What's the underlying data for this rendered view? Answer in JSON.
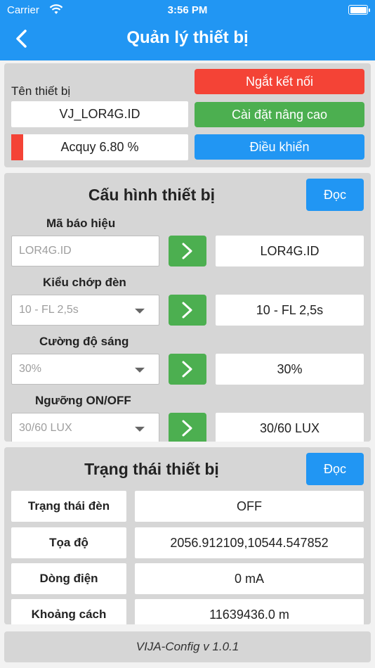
{
  "status_bar": {
    "carrier": "Carrier",
    "time": "3:56 PM"
  },
  "header": {
    "title": "Quản lý thiết bị"
  },
  "device": {
    "name_label": "Tên thiết bị",
    "name_value": "VJ_LOR4G.ID",
    "battery_text": "Acquy 6.80 %",
    "battery_level": 0.068,
    "disconnect_label": "Ngắt kết nối",
    "advanced_label": "Cài đặt nâng cao",
    "control_label": "Điều khiển"
  },
  "config": {
    "title": "Cấu hình thiết bị",
    "read_label": "Đọc",
    "fields": [
      {
        "label": "Mã báo hiệu",
        "input": "LOR4G.ID",
        "value": "LOR4G.ID",
        "type": "text"
      },
      {
        "label": "Kiểu chớp đèn",
        "input": "10 - FL 2,5s",
        "value": "10 - FL 2,5s",
        "type": "select"
      },
      {
        "label": "Cường độ sáng",
        "input": "30%",
        "value": "30%",
        "type": "select"
      },
      {
        "label": "Ngưỡng ON/OFF",
        "input": "30/60 LUX",
        "value": "30/60 LUX",
        "type": "select"
      }
    ]
  },
  "state": {
    "title": "Trạng thái thiết bị",
    "read_label": "Đọc",
    "rows": [
      {
        "label": "Trạng thái đèn",
        "value": "OFF"
      },
      {
        "label": "Tọa độ",
        "value": "2056.912109,10544.547852"
      },
      {
        "label": "Dòng điện",
        "value": "0 mA"
      },
      {
        "label": "Khoảng cách",
        "value": "11639436.0 m"
      }
    ]
  },
  "footer": {
    "version": "VIJA-Config v 1.0.1"
  },
  "colors": {
    "primary": "#2196f3",
    "danger": "#f44336",
    "success": "#4caf50",
    "panel": "#d6d6d6"
  }
}
